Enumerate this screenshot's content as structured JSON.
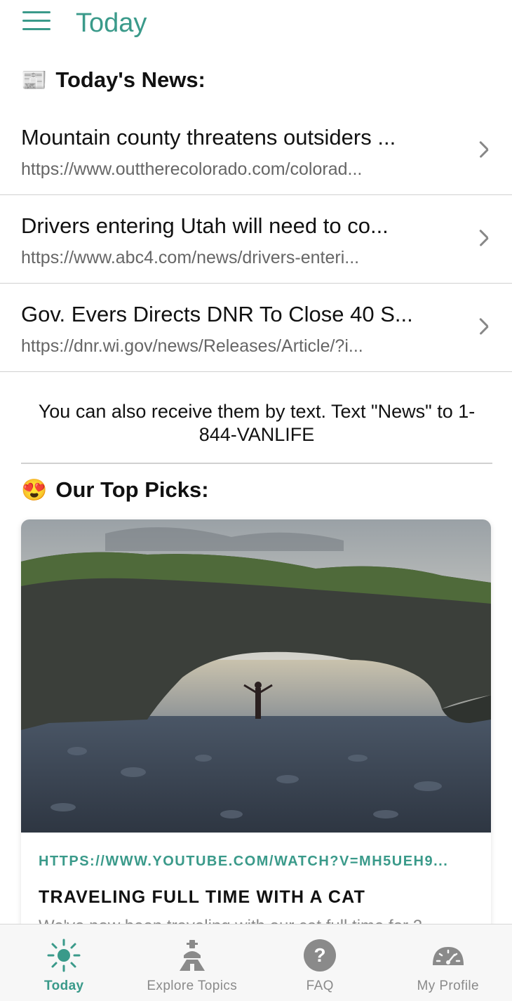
{
  "header": {
    "title": "Today",
    "menu_icon": "hamburger-menu-icon"
  },
  "news": {
    "heading": "Today's News:",
    "heading_icon": "newspaper-icon",
    "items": [
      {
        "title": "Mountain county threatens outsiders ...",
        "url": "https://www.outtherecolorado.com/colorad..."
      },
      {
        "title": "Drivers entering Utah will need to co...",
        "url": "https://www.abc4.com/news/drivers-enteri..."
      },
      {
        "title": "Gov. Evers Directs DNR To Close 40 S...",
        "url": "https://dnr.wi.gov/news/Releases/Article/?i..."
      }
    ],
    "sms_note": "You can also receive them by text. Text \"News\" to 1-844-VANLIFE"
  },
  "picks": {
    "heading": "Our Top Picks:",
    "heading_icon": "heart-eyes-emoji-icon",
    "card": {
      "url": "HTTPS://WWW.YOUTUBE.COM/WATCH?V=MH5UEH9...",
      "title": "TRAVELING FULL TIME WITH A CAT",
      "description": "We've now been traveling with our cat full time for 2"
    }
  },
  "tabbar": {
    "tabs": [
      {
        "label": "Today",
        "icon": "sun-icon",
        "active": true
      },
      {
        "label": "Explore Topics",
        "icon": "campfire-icon",
        "active": false
      },
      {
        "label": "FAQ",
        "icon": "question-mark-icon",
        "active": false
      },
      {
        "label": "My Profile",
        "icon": "speedometer-icon",
        "active": false
      }
    ]
  },
  "colors": {
    "accent": "#3a9a8a",
    "inactive_tab": "#8a8a8a",
    "divider": "#d0d0d0"
  }
}
